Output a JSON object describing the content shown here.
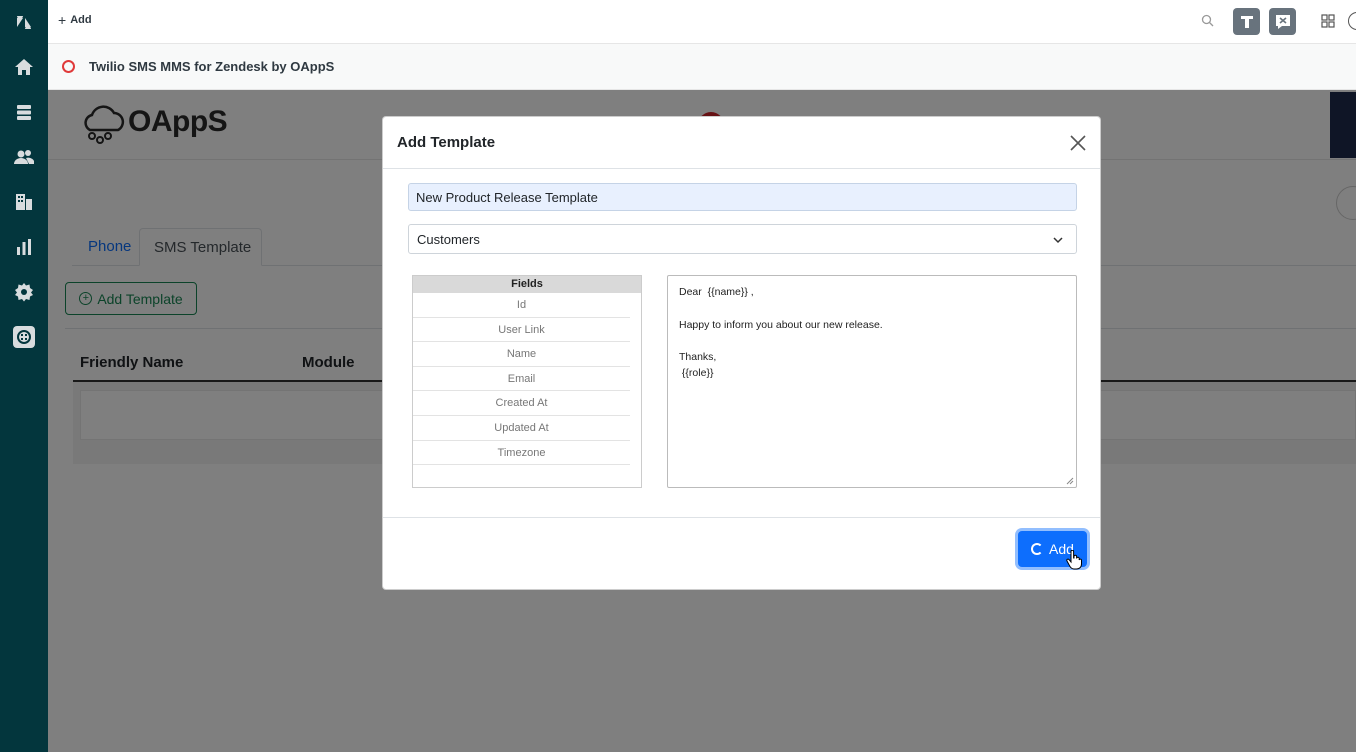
{
  "topbar": {
    "add_label": "Add"
  },
  "app_header": {
    "title": "Twilio SMS MMS for Zendesk by OAppS"
  },
  "app": {
    "logo_text": "OAppS",
    "tabs": [
      {
        "label": "Phone"
      },
      {
        "label": "SMS Template"
      }
    ],
    "add_template_label": "Add Template",
    "table_headers": [
      "Friendly Name",
      "Module"
    ]
  },
  "modal": {
    "title": "Add Template",
    "name_value": "New Product Release Template",
    "module_value": "Customers",
    "fields_header": "Fields",
    "fields": [
      "Id",
      "User Link",
      "Name",
      "Email",
      "Created At",
      "Updated At",
      "Timezone"
    ],
    "message_lines": [
      "Dear  {{name}} ,",
      "",
      "Happy to inform you about our new release.",
      "",
      "Thanks,",
      " {{role}}"
    ],
    "submit_label": "Add"
  },
  "colors": {
    "nav_bg": "#03363d",
    "primary": "#0d6efd",
    "success": "#198754",
    "brand_red": "#cc2229"
  }
}
